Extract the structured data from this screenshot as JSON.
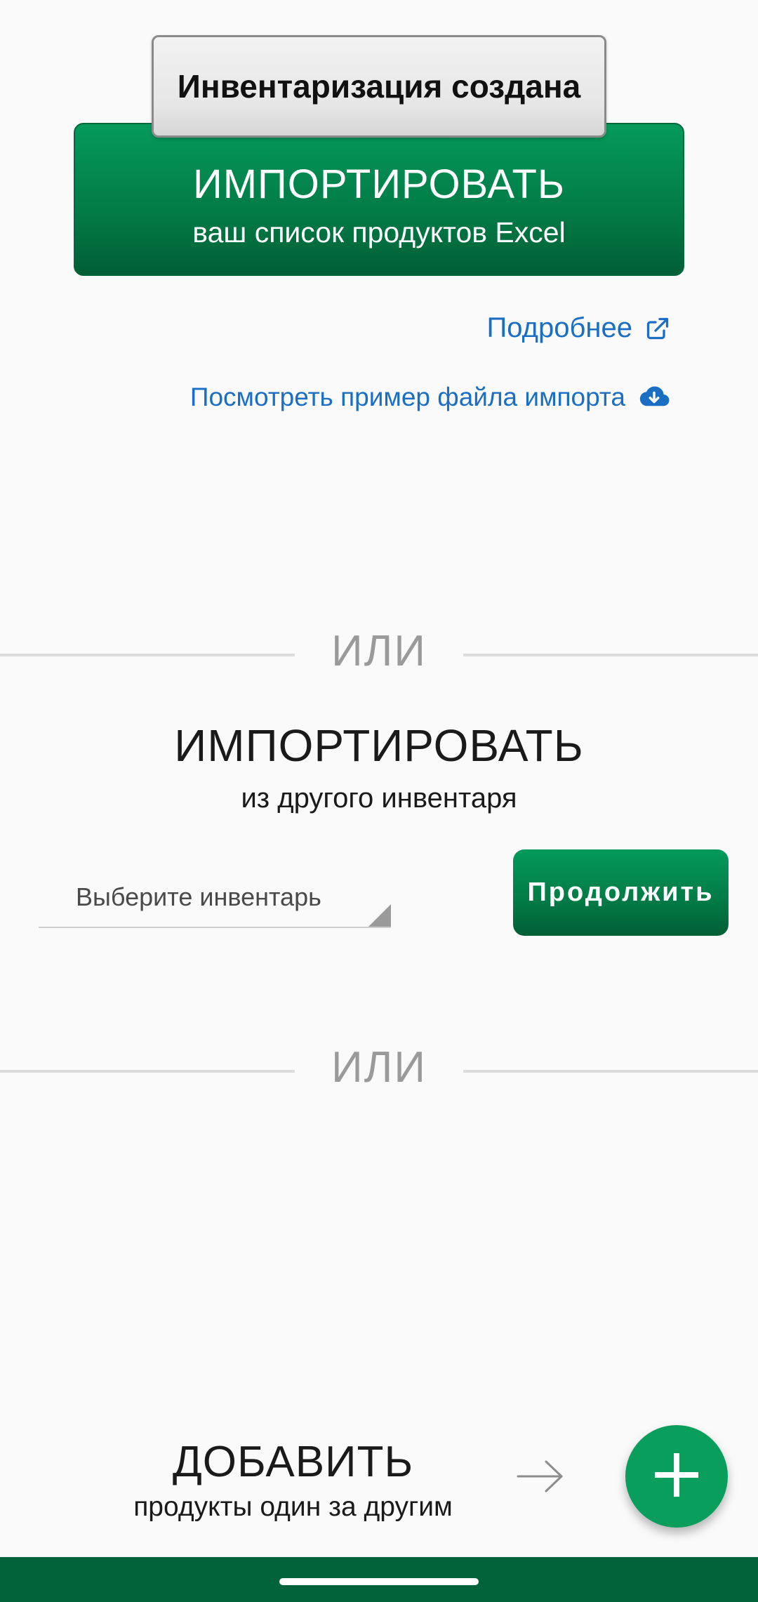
{
  "toast": {
    "text": "Инвентаризация создана"
  },
  "import_excel": {
    "title": "ИМПОРТИРОВАТЬ",
    "subtitle": "ваш список продуктов Excel"
  },
  "links": {
    "more": {
      "label": "Подробнее",
      "icon": "external-link-icon"
    },
    "sample": {
      "label": "Посмотреть пример файла импорта",
      "icon": "cloud-download-icon"
    }
  },
  "separators": {
    "or_text": "ИЛИ"
  },
  "import_other": {
    "title": "ИМПОРТИРОВАТЬ",
    "subtitle": "из другого инвентаря",
    "select_placeholder": "Выберите инвентарь",
    "continue_label": "Продолжить"
  },
  "add_products": {
    "title": "ДОБАВИТЬ",
    "subtitle": "продукты один за другим",
    "arrow_icon": "arrow-right-icon",
    "fab_icon": "plus-icon"
  },
  "colors": {
    "brand_green": "#027a45",
    "fab_green": "#0a9e5d",
    "link_blue": "#1a6fc4",
    "nav_bar": "#02633a"
  }
}
